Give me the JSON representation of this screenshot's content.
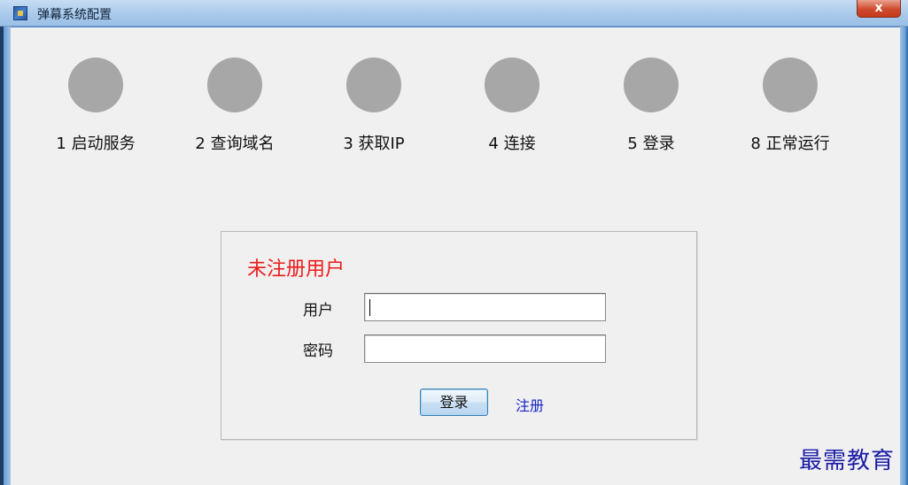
{
  "window": {
    "title": "弹幕系统配置",
    "close_label": "x"
  },
  "steps": [
    {
      "label": "1 启动服务"
    },
    {
      "label": "2 查询域名"
    },
    {
      "label": "3 获取IP"
    },
    {
      "label": "4 连接"
    },
    {
      "label": "5 登录"
    },
    {
      "label": "8 正常运行"
    }
  ],
  "login_panel": {
    "title": "未注册用户",
    "user_label": "用户",
    "user_value": "",
    "password_label": "密码",
    "password_value": "",
    "login_button": "登录",
    "register_link": "注册"
  },
  "watermark": "最需教育",
  "colors": {
    "status_dot": "#a7a7a7",
    "panel_title": "#ee1b1b",
    "link": "#1522c8"
  }
}
